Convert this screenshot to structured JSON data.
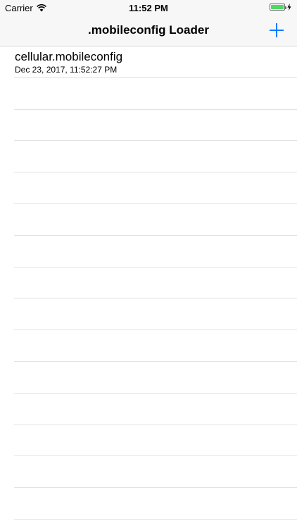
{
  "status_bar": {
    "carrier": "Carrier",
    "time": "11:52 PM",
    "battery_level": 1.0,
    "battery_color": "#4cd964"
  },
  "nav_bar": {
    "title": ".mobileconfig Loader",
    "add_icon": "plus-icon",
    "accent_color": "#007aff"
  },
  "list": {
    "items": [
      {
        "title": "cellular.mobileconfig",
        "subtitle": "Dec 23, 2017, 11:52:27 PM"
      }
    ],
    "empty_rows": 14
  }
}
